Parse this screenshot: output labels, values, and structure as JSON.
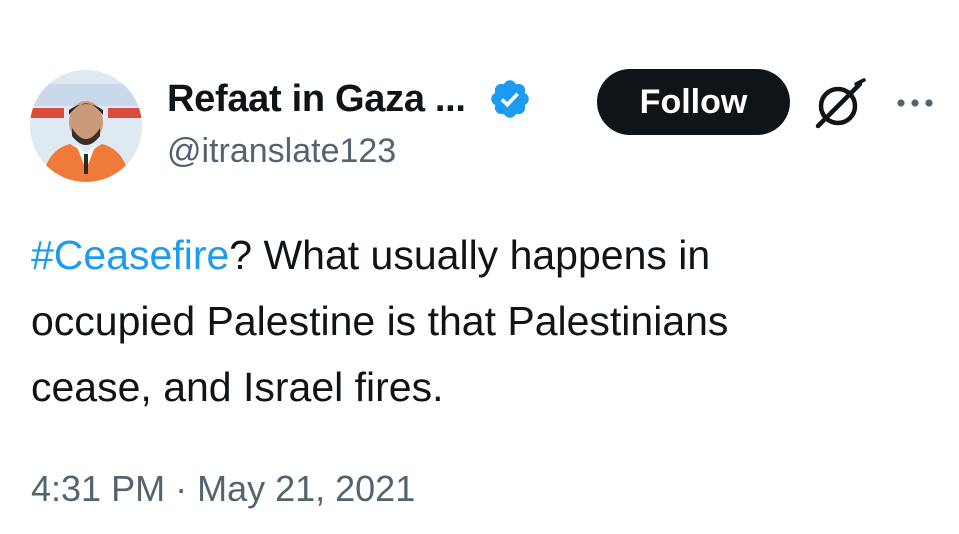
{
  "tweet": {
    "author": {
      "display_name": "Refaat in Gaza ...",
      "handle": "@itranslate123",
      "verified_icon": "verified-badge-icon"
    },
    "actions": {
      "follow_label": "Follow",
      "grok_icon": "grok-icon",
      "more_icon": "more-options-icon"
    },
    "text": {
      "hashtag": "#Ceasefire",
      "line1_rest": "? What usually happens in",
      "line2": "occupied Palestine is that Palestinians",
      "line3": "cease, and Israel fires."
    },
    "meta": {
      "time": "4:31 PM",
      "separator": " · ",
      "date": "May 21, 2021"
    },
    "colors": {
      "link": "#1d9bf0",
      "text": "#0f1419",
      "secondary": "#536471",
      "button_bg": "#0f1419",
      "button_text": "#ffffff"
    }
  }
}
